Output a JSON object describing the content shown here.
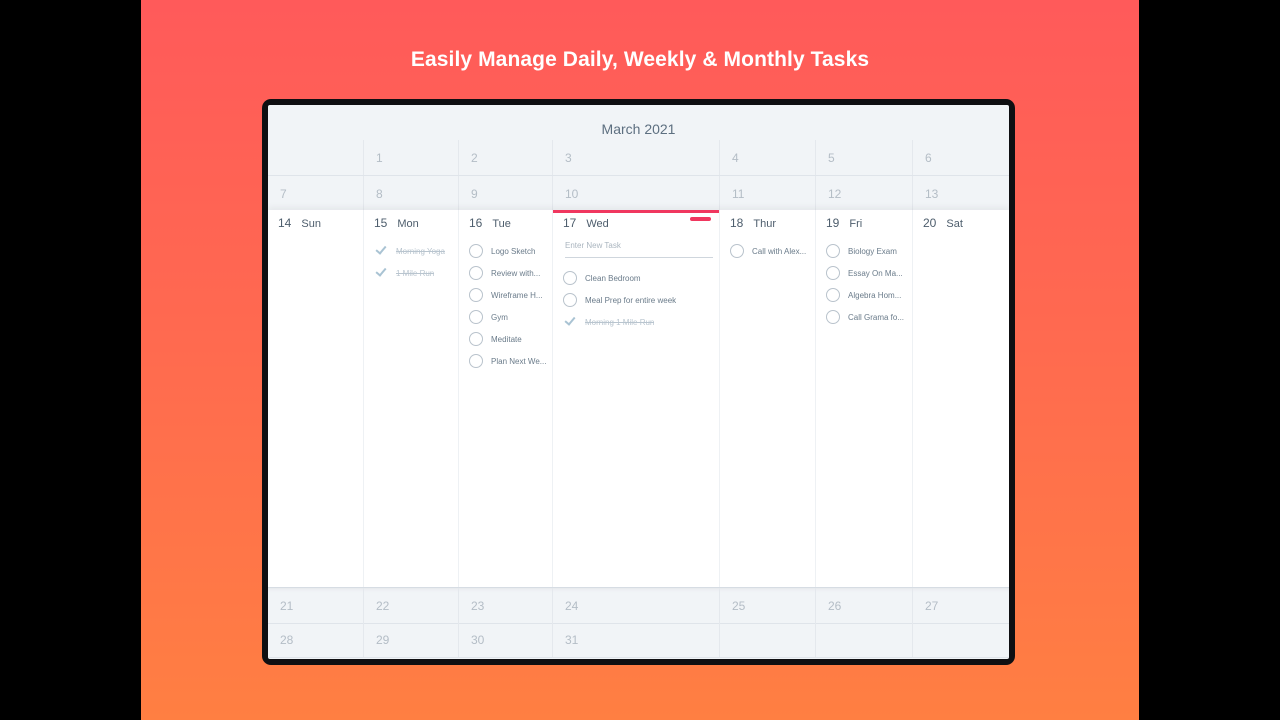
{
  "headline": "Easily Manage Daily, Weekly & Monthly Tasks",
  "calendar": {
    "month_title": "March 2021",
    "row0": [
      "",
      "1",
      "2",
      "3",
      "4",
      "5",
      "6"
    ],
    "row1": [
      "7",
      "8",
      "9",
      "10",
      "11",
      "12",
      "13"
    ],
    "row3": [
      "21",
      "22",
      "23",
      "24",
      "25",
      "26",
      "27"
    ],
    "row4": [
      "28",
      "29",
      "30",
      "31",
      "",
      "",
      ""
    ],
    "week": [
      {
        "num": "14",
        "name": "Sun",
        "tasks": []
      },
      {
        "num": "15",
        "name": "Mon",
        "tasks": [
          {
            "label": "Morning Yoga",
            "done": true
          },
          {
            "label": "1 Mile Run",
            "done": true
          }
        ]
      },
      {
        "num": "16",
        "name": "Tue",
        "tasks": [
          {
            "label": "Logo Sketch",
            "done": false
          },
          {
            "label": "Review with...",
            "done": false
          },
          {
            "label": "Wireframe H...",
            "done": false
          },
          {
            "label": "Gym",
            "done": false
          },
          {
            "label": "Meditate",
            "done": false
          },
          {
            "label": "Plan Next We...",
            "done": false
          }
        ]
      },
      {
        "num": "17",
        "name": "Wed",
        "today": true,
        "new_task_placeholder": "Enter New Task",
        "tasks": [
          {
            "label": "Clean Bedroom",
            "done": false
          },
          {
            "label": "Meal Prep for entire week",
            "done": false
          },
          {
            "label": "Morning 1 Mile Run",
            "done": true
          }
        ]
      },
      {
        "num": "18",
        "name": "Thur",
        "tasks": [
          {
            "label": "Call with Alex...",
            "done": false
          }
        ]
      },
      {
        "num": "19",
        "name": "Fri",
        "tasks": [
          {
            "label": "Biology Exam",
            "done": false
          },
          {
            "label": "Essay On Ma...",
            "done": false
          },
          {
            "label": "Algebra Hom...",
            "done": false
          },
          {
            "label": "Call Grama fo...",
            "done": false
          }
        ]
      },
      {
        "num": "20",
        "name": "Sat",
        "tasks": []
      }
    ]
  },
  "colors": {
    "accent": "#f0375f",
    "gradient_top": "#ff5a5a",
    "gradient_bottom": "#ff7f42"
  }
}
